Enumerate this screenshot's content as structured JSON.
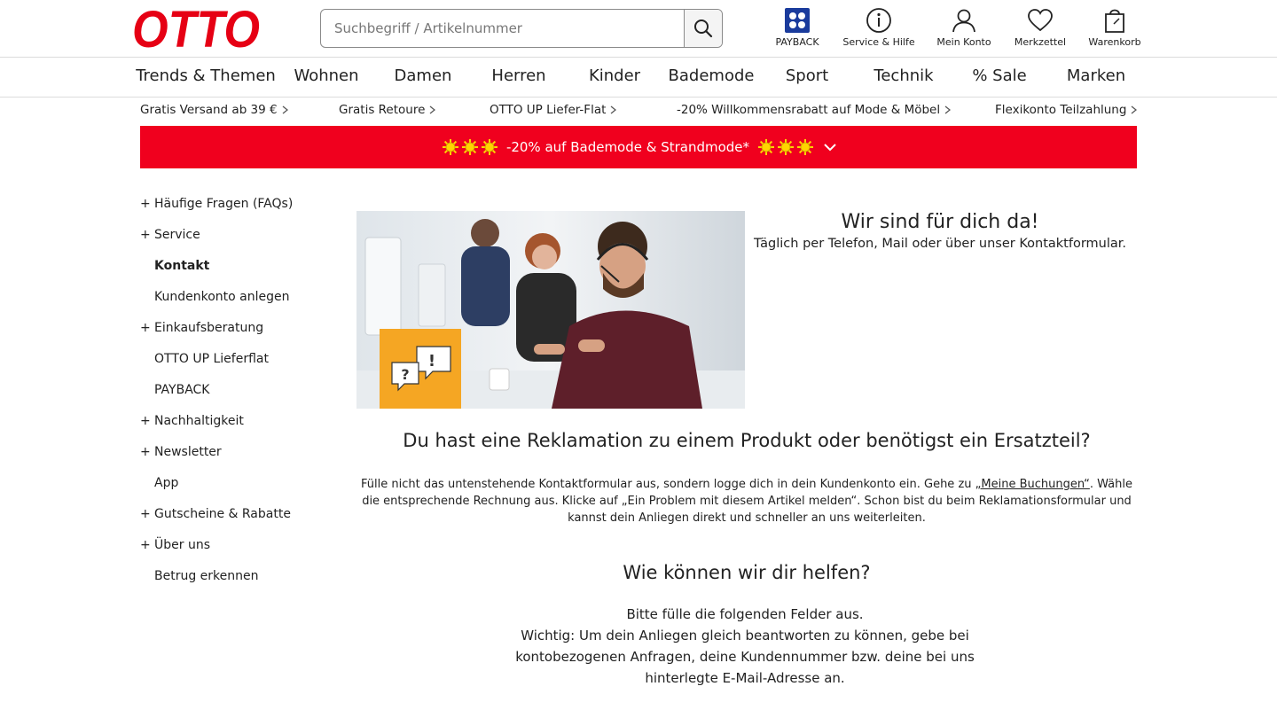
{
  "header": {
    "logo_text": "OTTO",
    "search_placeholder": "Suchbegriff / Artikelnummer",
    "icons": [
      {
        "label": "PAYBACK",
        "icon": "payback-icon"
      },
      {
        "label": "Service & Hilfe",
        "icon": "info-icon"
      },
      {
        "label": "Mein Konto",
        "icon": "user-icon"
      },
      {
        "label": "Merkzettel",
        "icon": "heart-icon"
      },
      {
        "label": "Warenkorb",
        "icon": "shopping-bag-icon"
      }
    ]
  },
  "nav": {
    "items": [
      "Trends & Themen",
      "Wohnen",
      "Damen",
      "Herren",
      "Kinder",
      "Bademode",
      "Sport",
      "Technik",
      "% Sale",
      "Marken"
    ]
  },
  "usp": {
    "items": [
      "Gratis Versand ab 39 €",
      "Gratis Retoure",
      "OTTO UP Liefer-Flat",
      "-20% Willkommensrabatt auf Mode & Möbel",
      "Flexikonto Teilzahlung"
    ]
  },
  "banner": {
    "text": "-20% auf Bademode & Strandmode*",
    "color": "#f0001e"
  },
  "sidebar": {
    "items": [
      {
        "label": "Häufige Fragen (FAQs)",
        "expandable": true
      },
      {
        "label": "Service",
        "expandable": true
      },
      {
        "label": "Kontakt",
        "expandable": false,
        "active": true
      },
      {
        "label": "Kundenkonto anlegen",
        "expandable": false
      },
      {
        "label": "Einkaufsberatung",
        "expandable": true
      },
      {
        "label": "OTTO UP Lieferflat",
        "expandable": false
      },
      {
        "label": "PAYBACK",
        "expandable": false
      },
      {
        "label": "Nachhaltigkeit",
        "expandable": true
      },
      {
        "label": "Newsletter",
        "expandable": true
      },
      {
        "label": "App",
        "expandable": false
      },
      {
        "label": "Gutscheine & Rabatte",
        "expandable": true
      },
      {
        "label": "Über uns",
        "expandable": true
      },
      {
        "label": "Betrug erkennen",
        "expandable": false
      }
    ],
    "plus_symbol": "+"
  },
  "content": {
    "hero_title": "Wir sind für dich da!",
    "hero_subtitle": "Täglich per Telefon, Mail oder über unser Kontaktformular.",
    "complaint_heading": "Du hast eine Reklamation zu einem Produkt oder benötigst ein Ersatzteil?",
    "complaint_text_1": "Fülle nicht das untenstehende Kontaktformular aus, sondern logge dich in dein Kundenkonto ein. Gehe zu ",
    "complaint_link": "„Meine Buchungen“",
    "complaint_text_2": ". Wähle die entsprechende Rechnung aus. Klicke auf „Ein Problem mit diesem Artikel melden“. Schon bist du beim Reklamationsformular und kannst dein Anliegen direkt und schneller an uns weiterleiten.",
    "help_heading": "Wie können wir dir helfen?",
    "help_line_1": "Bitte fülle die folgenden Felder aus.",
    "help_line_2": "Wichtig: Um dein Anliegen gleich beantworten zu können, gebe bei kontobezogenen Anfragen, deine Kundennummer bzw. deine bei uns hinterlegte E-Mail-Adresse an."
  },
  "colors": {
    "brand_red": "#f0001e",
    "payback_blue": "#1a3b9c",
    "hero_badge": "#f5a623"
  }
}
